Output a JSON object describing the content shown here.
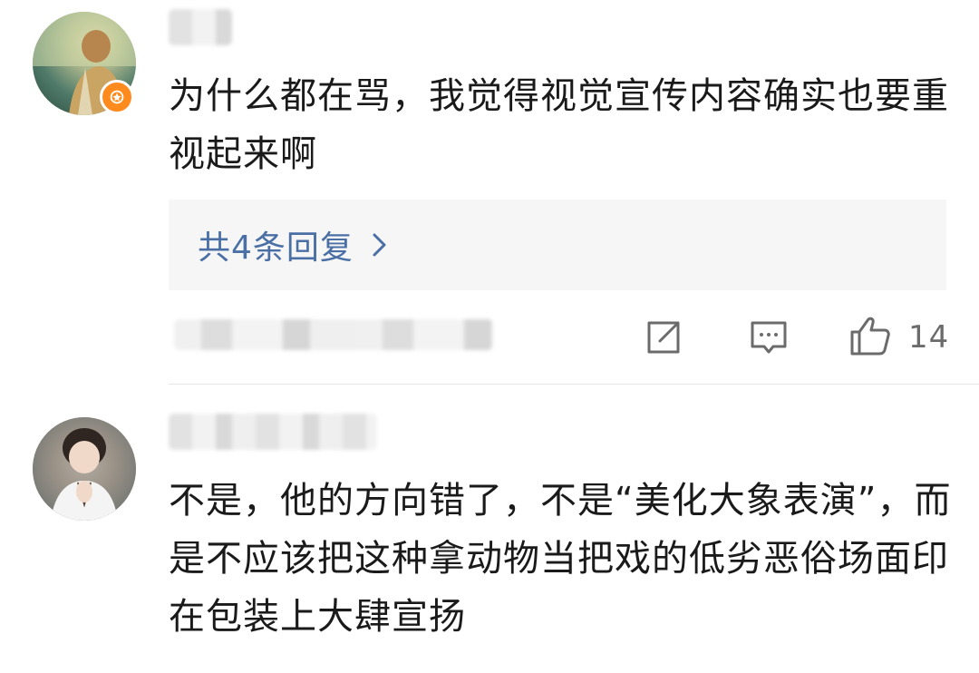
{
  "comments": [
    {
      "text": "为什么都在骂，我觉得视觉宣传内容确实也要重视起来啊",
      "replies_label": "共4条回复",
      "like_count": "14"
    },
    {
      "text": "不是，他的方向错了，不是“美化大象表演”，而是不应该把这种拿动物当把戏的低劣恶俗场面印在包装上大肆宣扬"
    }
  ],
  "colors": {
    "reply_link": "#4a6fa5",
    "reply_box_bg": "#f6f6f6",
    "verify_badge": "#ff8a1e",
    "icon_gray": "#6b6b6b"
  },
  "icons": {
    "share": "share-icon",
    "reply": "comment-icon",
    "like": "thumbs-up-icon",
    "chevron": "chevron-right-icon",
    "badge": "verified-badge-icon"
  }
}
